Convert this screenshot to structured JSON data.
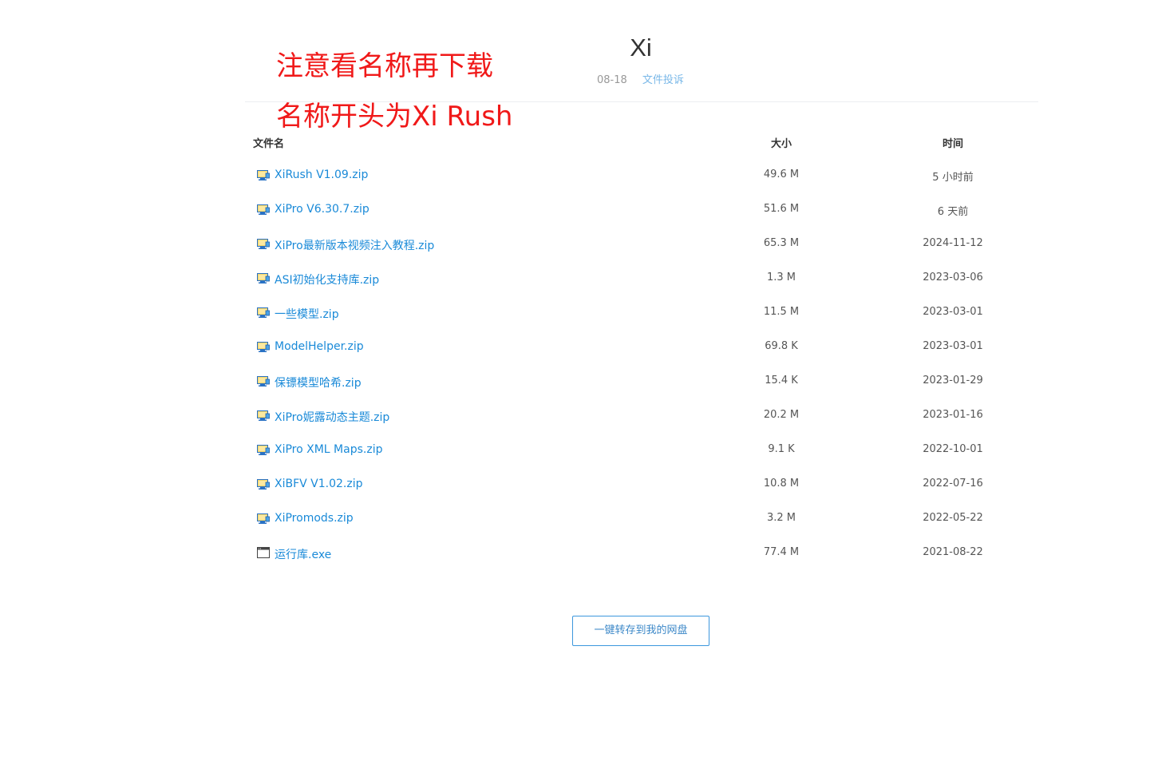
{
  "annotations": [
    "注意看名称再下载",
    "名称开头为Xi Rush"
  ],
  "share": {
    "title": "Xi",
    "date": "08-18",
    "report_link": "文件投诉"
  },
  "table": {
    "headers": {
      "name": "文件名",
      "size": "大小",
      "time": "时间"
    },
    "rows": [
      {
        "icon": "zip-archive-icon",
        "name": "XiRush V1.09.zip",
        "size": "49.6 M",
        "time": "5 小时前"
      },
      {
        "icon": "zip-archive-icon",
        "name": "XiPro V6.30.7.zip",
        "size": "51.6 M",
        "time": "6 天前"
      },
      {
        "icon": "zip-archive-icon",
        "name": "XiPro最新版本视频注入教程.zip",
        "size": "65.3 M",
        "time": "2024-11-12"
      },
      {
        "icon": "zip-archive-icon",
        "name": "ASI初始化支持库.zip",
        "size": "1.3 M",
        "time": "2023-03-06"
      },
      {
        "icon": "zip-archive-icon",
        "name": "一些模型.zip",
        "size": "11.5 M",
        "time": "2023-03-01"
      },
      {
        "icon": "zip-archive-icon",
        "name": "ModelHelper.zip",
        "size": "69.8 K",
        "time": "2023-03-01"
      },
      {
        "icon": "zip-archive-icon",
        "name": "保镖模型哈希.zip",
        "size": "15.4 K",
        "time": "2023-01-29"
      },
      {
        "icon": "zip-archive-icon",
        "name": "XiPro妮露动态主题.zip",
        "size": "20.2 M",
        "time": "2023-01-16"
      },
      {
        "icon": "zip-archive-icon",
        "name": "XiPro XML Maps.zip",
        "size": "9.1 K",
        "time": "2022-10-01"
      },
      {
        "icon": "zip-archive-icon",
        "name": "XiBFV V1.02.zip",
        "size": "10.8 M",
        "time": "2022-07-16"
      },
      {
        "icon": "zip-archive-icon",
        "name": "XiPromods.zip",
        "size": "3.2 M",
        "time": "2022-05-22"
      },
      {
        "icon": "exe-window-icon",
        "name": "运行库.exe",
        "size": "77.4 M",
        "time": "2021-08-22"
      }
    ]
  },
  "actions": {
    "save_to_disk": "一键转存到我的网盘"
  },
  "colors": {
    "annotation": "#f01919",
    "link": "#1a8ad8",
    "report_link": "#7ab8e8",
    "button_border": "#3c97dd"
  }
}
